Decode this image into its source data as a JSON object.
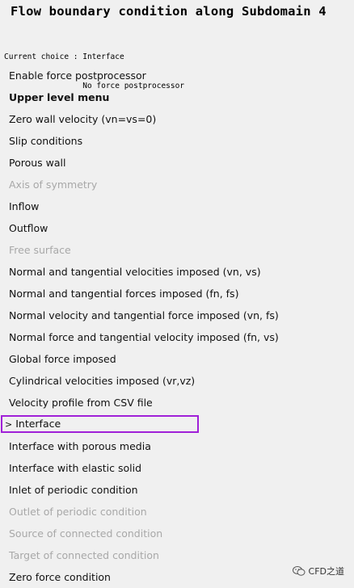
{
  "title": "Flow boundary condition along Subdomain 4",
  "current_choice": {
    "label": "Current choice : ",
    "values": [
      "Interface",
      "No force postprocessor"
    ]
  },
  "menu": [
    {
      "label": "Enable force postprocessor",
      "state": "normal"
    },
    {
      "label": "Upper level menu",
      "state": "bold"
    },
    {
      "label": "Zero wall velocity (vn=vs=0)",
      "state": "normal"
    },
    {
      "label": "Slip conditions",
      "state": "normal"
    },
    {
      "label": "Porous wall",
      "state": "normal"
    },
    {
      "label": "Axis of symmetry",
      "state": "disabled"
    },
    {
      "label": "Inflow",
      "state": "normal"
    },
    {
      "label": "Outflow",
      "state": "normal"
    },
    {
      "label": "Free surface",
      "state": "disabled"
    },
    {
      "label": "Normal and tangential velocities imposed (vn, vs)",
      "state": "normal"
    },
    {
      "label": "Normal and tangential forces imposed (fn, fs)",
      "state": "normal"
    },
    {
      "label": "Normal velocity and tangential force imposed (vn, fs)",
      "state": "normal"
    },
    {
      "label": "Normal force and tangential velocity imposed (fn, vs)",
      "state": "normal"
    },
    {
      "label": "Global force imposed",
      "state": "normal"
    },
    {
      "label": "Cylindrical velocities imposed (vr,vz)",
      "state": "normal"
    },
    {
      "label": "Velocity profile from CSV file",
      "state": "normal"
    },
    {
      "label": "Interface",
      "state": "selected",
      "marker": ">"
    },
    {
      "label": "Interface with porous media",
      "state": "normal"
    },
    {
      "label": "Interface with elastic solid",
      "state": "normal"
    },
    {
      "label": "Inlet of periodic condition",
      "state": "normal"
    },
    {
      "label": "Outlet of periodic condition",
      "state": "disabled"
    },
    {
      "label": "Source of connected condition",
      "state": "disabled"
    },
    {
      "label": "Target of connected condition",
      "state": "disabled"
    },
    {
      "label": "Zero force condition",
      "state": "normal"
    }
  ],
  "watermark": {
    "text": "CFD之道",
    "icon": "wechat-icon"
  },
  "colors": {
    "selection_outline": "#a020d8",
    "disabled_text": "#a8a8a8",
    "background": "#f0f0f0"
  }
}
